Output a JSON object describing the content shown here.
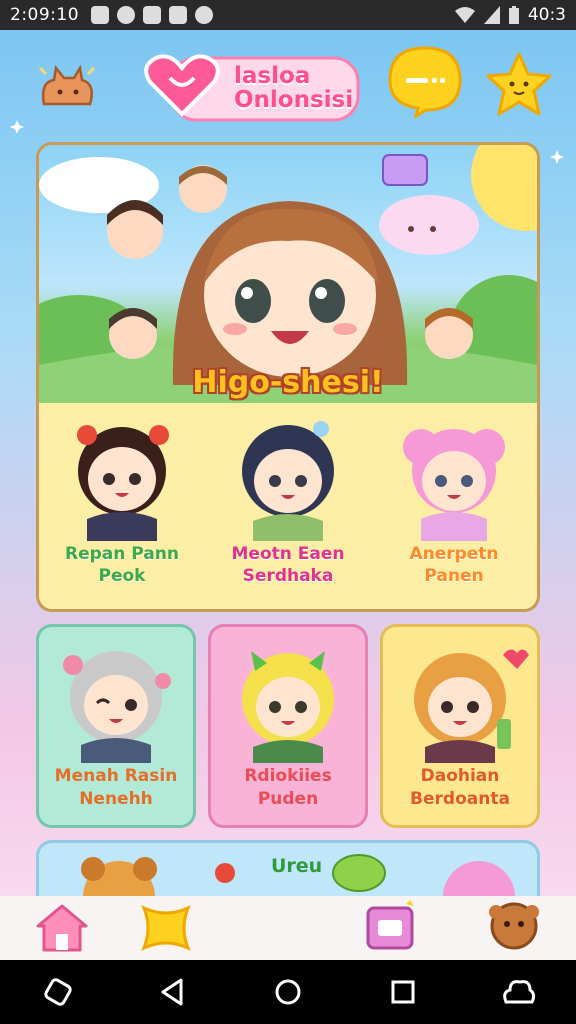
{
  "status_bar": {
    "time": "2:09:10",
    "right_text": "40:3"
  },
  "header": {
    "logo_line1": "lasloa",
    "logo_line2": "Onlonsisi",
    "icons": [
      "cat-icon",
      "heart-icon",
      "chat-bubble-icon",
      "star-icon"
    ]
  },
  "featured": {
    "title": "Higo-shesi!",
    "speech_label": "",
    "characters": [
      {
        "name_line1": "Repan Pann",
        "name_line2": "Peok"
      },
      {
        "name_line1": "Meotn Eaen",
        "name_line2": "Serdhaka"
      },
      {
        "name_line1": "Anerpetn",
        "name_line2": "Panen"
      }
    ]
  },
  "cards": [
    {
      "name_line1": "Menah Rasin",
      "name_line2": "Nenehh"
    },
    {
      "name_line1": "Rdiokiies",
      "name_line2": "Puden"
    },
    {
      "name_line1": "Daohian",
      "name_line2": "Berdoanta"
    }
  ],
  "peek_card": {
    "label": "Ureu"
  },
  "bottom_nav": [
    "home-icon",
    "star-icon",
    "chat-icon",
    "profile-icon"
  ],
  "colors": {
    "accent_pink": "#ff4f8f",
    "title_yellow": "#ffc21f",
    "card_mint": "#b2ead7",
    "card_pink": "#f8b3d7",
    "card_yellow": "#fde88f"
  }
}
